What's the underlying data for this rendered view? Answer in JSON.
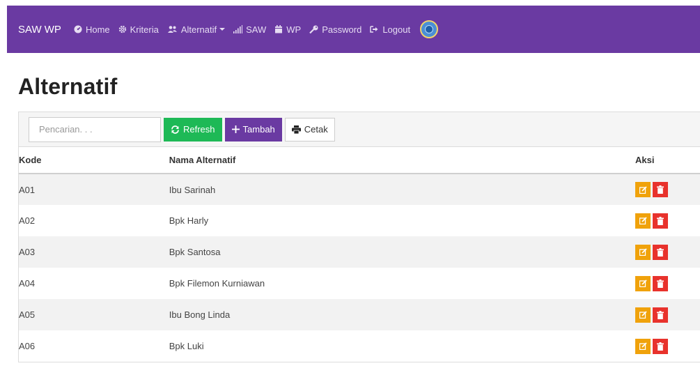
{
  "navbar": {
    "brand": "SAW WP",
    "items": [
      {
        "label": "Home",
        "icon": "dashboard-icon"
      },
      {
        "label": "Kriteria",
        "icon": "gear-icon"
      },
      {
        "label": "Alternatif",
        "icon": "users-icon",
        "dropdown": true
      },
      {
        "label": "SAW",
        "icon": "signal-icon"
      },
      {
        "label": "WP",
        "icon": "calendar-icon"
      },
      {
        "label": "Password",
        "icon": "key-icon"
      },
      {
        "label": "Logout",
        "icon": "logout-icon"
      }
    ]
  },
  "page": {
    "title": "Alternatif"
  },
  "toolbar": {
    "search_placeholder": "Pencarian. . .",
    "refresh_label": "Refresh",
    "add_label": "Tambah",
    "print_label": "Cetak"
  },
  "table": {
    "headers": [
      "Kode",
      "Nama Alternatif",
      "Aksi"
    ],
    "rows": [
      {
        "kode": "A01",
        "nama": "Ibu Sarinah"
      },
      {
        "kode": "A02",
        "nama": "Bpk Harly"
      },
      {
        "kode": "A03",
        "nama": "Bpk Santosa"
      },
      {
        "kode": "A04",
        "nama": "Bpk Filemon Kurniawan"
      },
      {
        "kode": "A05",
        "nama": "Ibu Bong Linda"
      },
      {
        "kode": "A06",
        "nama": "Bpk Luki"
      }
    ]
  },
  "colors": {
    "navbar": "#6a3aa2",
    "refresh": "#1eb956",
    "add": "#6a3aa2",
    "edit": "#f0a20b",
    "delete": "#e8322c"
  }
}
